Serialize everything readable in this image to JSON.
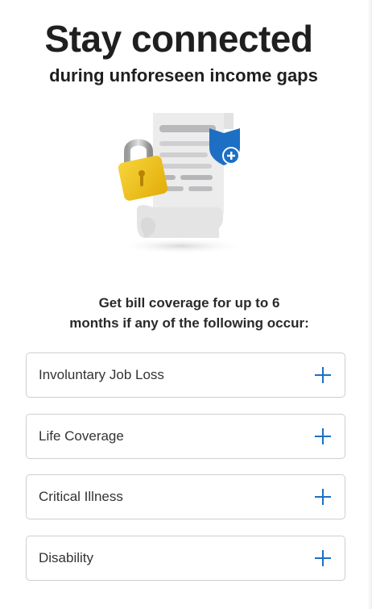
{
  "hero": {
    "title": "Stay connected",
    "subtitle": "during unforeseen income gaps"
  },
  "illustration": {
    "icon": "bill-with-lock-and-shield",
    "colors": {
      "lock": "#f2c21a",
      "shield": "#1d6fc4",
      "paper": "#e9e9ea"
    }
  },
  "intro": {
    "line1": "Get bill coverage for up to 6",
    "line2": "months if any of the following occur:"
  },
  "coverage_items": [
    {
      "label": "Involuntary Job Loss",
      "icon": "plus-icon"
    },
    {
      "label": "Life Coverage",
      "icon": "plus-icon"
    },
    {
      "label": "Critical Illness",
      "icon": "plus-icon"
    },
    {
      "label": "Disability",
      "icon": "plus-icon"
    }
  ],
  "colors": {
    "accent": "#1d6fc4",
    "border": "#cfcfcf",
    "text": "#1f1f1f"
  }
}
